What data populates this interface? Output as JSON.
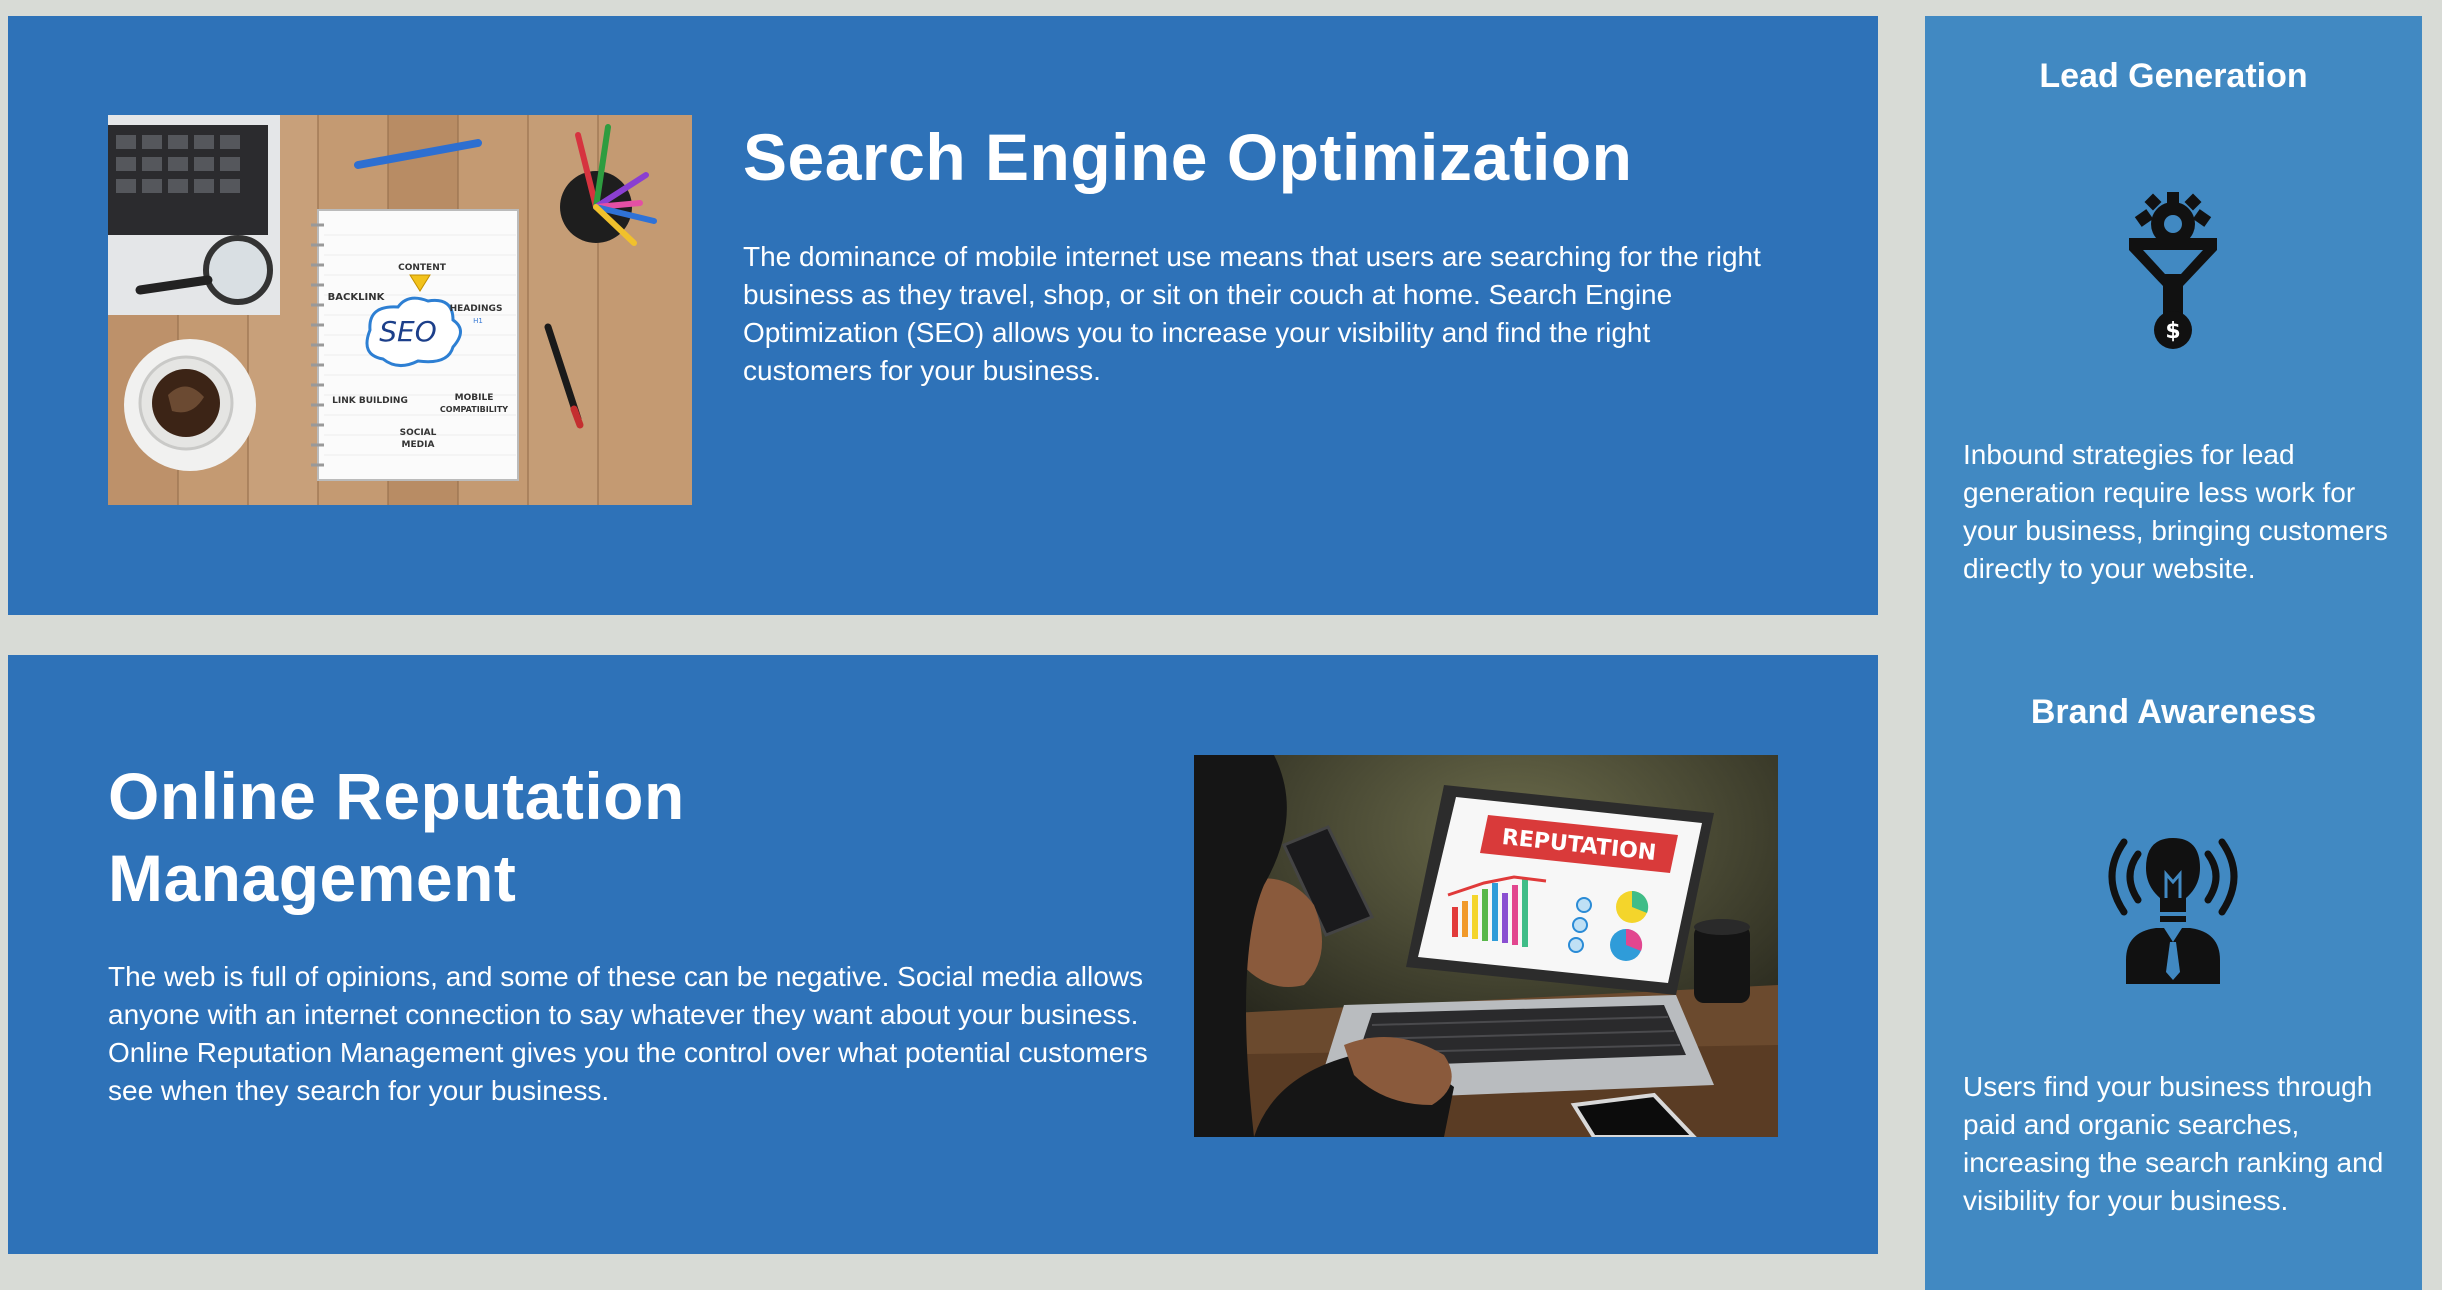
{
  "seo": {
    "title": "Search Engine Optimization",
    "body": "The dominance of mobile internet use means that users are searching for the right business as they travel, shop, or sit on their couch at home. Search Engine Optimization (SEO) allows you to increase your visibility and find the right customers for your business.",
    "image": {
      "center": "SEO",
      "words": [
        "CONTENT",
        "BACKLINK",
        "HEADINGS",
        "H1",
        "LINK BUILDING",
        "MOBILE",
        "COMPATIBILITY",
        "SOCIAL",
        "MEDIA"
      ]
    }
  },
  "orm": {
    "title_line1": "Online Reputation",
    "title_line2": "Management",
    "body": "The web is full of opinions, and some of these can be negative. Social media allows anyone with an internet connection to say whatever they want about your business. Online Reputation Management gives you the control over what potential customers see when they search for your business.",
    "image": {
      "screen_banner": "REPUTATION"
    }
  },
  "sidebar": {
    "lead": {
      "heading": "Lead Generation",
      "icon": "funnel-gear-dollar-icon",
      "text": "Inbound strategies for lead generation require less work for your business, bringing customers directly to your website."
    },
    "brand": {
      "heading": "Brand Awareness",
      "icon": "lightbulb-head-icon",
      "text": "Users find your business through paid and organic searches, increasing the search ranking and visibility for your business."
    }
  },
  "colors": {
    "page_background": "#d8dbd6",
    "panel_blue": "#2e72b8",
    "sidebar_blue": "#4189c2",
    "text": "#ffffff"
  }
}
